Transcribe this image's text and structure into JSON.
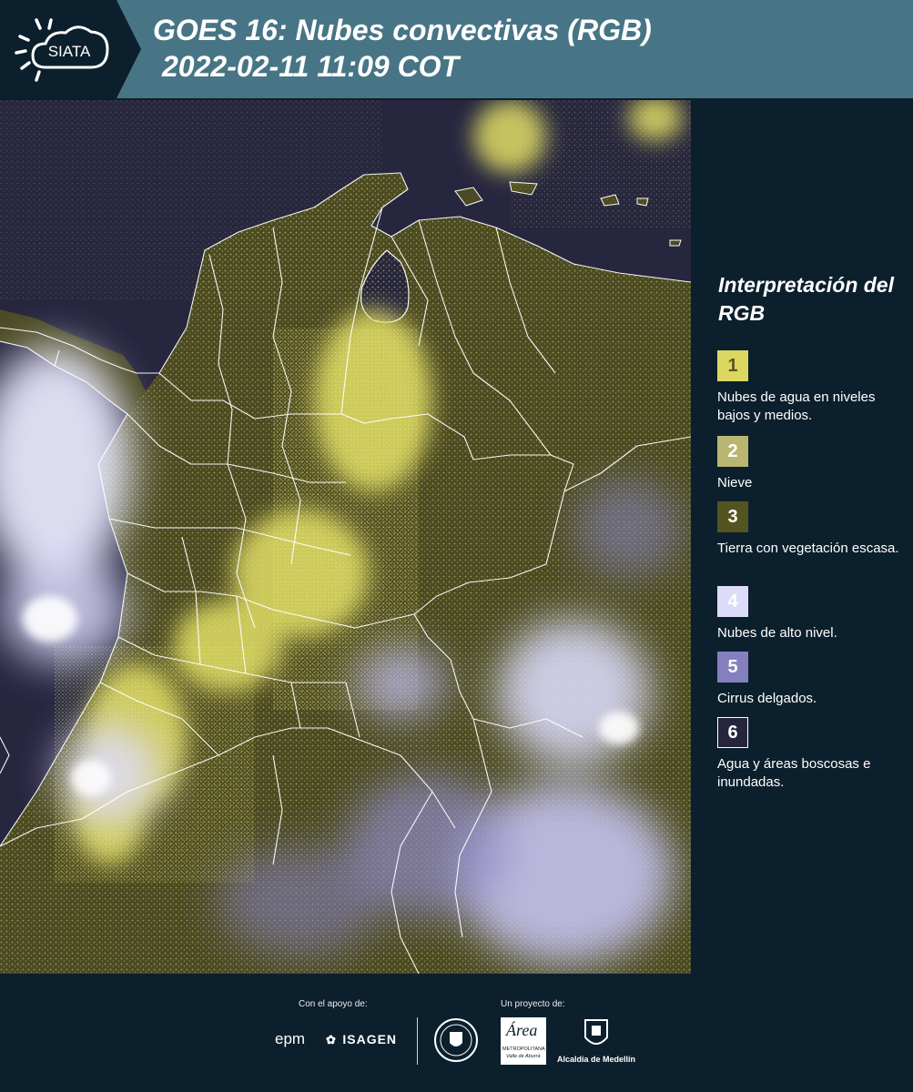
{
  "header": {
    "logo_text": "SIATA",
    "title": "GOES 16: Nubes convectivas (RGB)",
    "subtitle": "2022-02-11 11:09 COT",
    "background": "#477585"
  },
  "legend": {
    "title": "Interpretación del RGB",
    "items": [
      {
        "number": "1",
        "label": "Nubes de agua en niveles bajos y medios.",
        "color": "#dbd760",
        "text_color": "#5b5420"
      },
      {
        "number": "2",
        "label": "Nieve",
        "color": "#b9b672",
        "text_color": "#ffffff"
      },
      {
        "number": "3",
        "label": "Tierra con vegetación escasa.",
        "color": "#545420",
        "text_color": "#ffffff"
      },
      {
        "number": "4",
        "label": "Nubes de alto nivel.",
        "color": "#dcdcf8",
        "text_color": "#ffffff"
      },
      {
        "number": "5",
        "label": "Cirrus delgados.",
        "color": "#8480c0",
        "text_color": "#ffffff"
      },
      {
        "number": "6",
        "label": "Agua y áreas boscosas e inundadas.",
        "color": "#26253e",
        "text_color": "#ffffff"
      }
    ]
  },
  "footer": {
    "support_caption": "Con el apoyo de:",
    "project_caption": "Un proyecto de:",
    "sponsors": [
      "epm",
      "ISAGEN"
    ],
    "partners": {
      "area_logo_text": "Área",
      "area_sub": "METROPOLITANA",
      "area_sub2": "Valle de Aburrá",
      "alcaldia": "Alcaldía de Medellín"
    }
  },
  "map": {
    "colors": {
      "ocean": "#26253e",
      "land_vegetated": "#4a4a22",
      "low_clouds": "#d8d35a",
      "high_clouds": "#dcdcf5",
      "thin_cirrus": "#8a86c4",
      "borders": "#ffffff"
    }
  }
}
